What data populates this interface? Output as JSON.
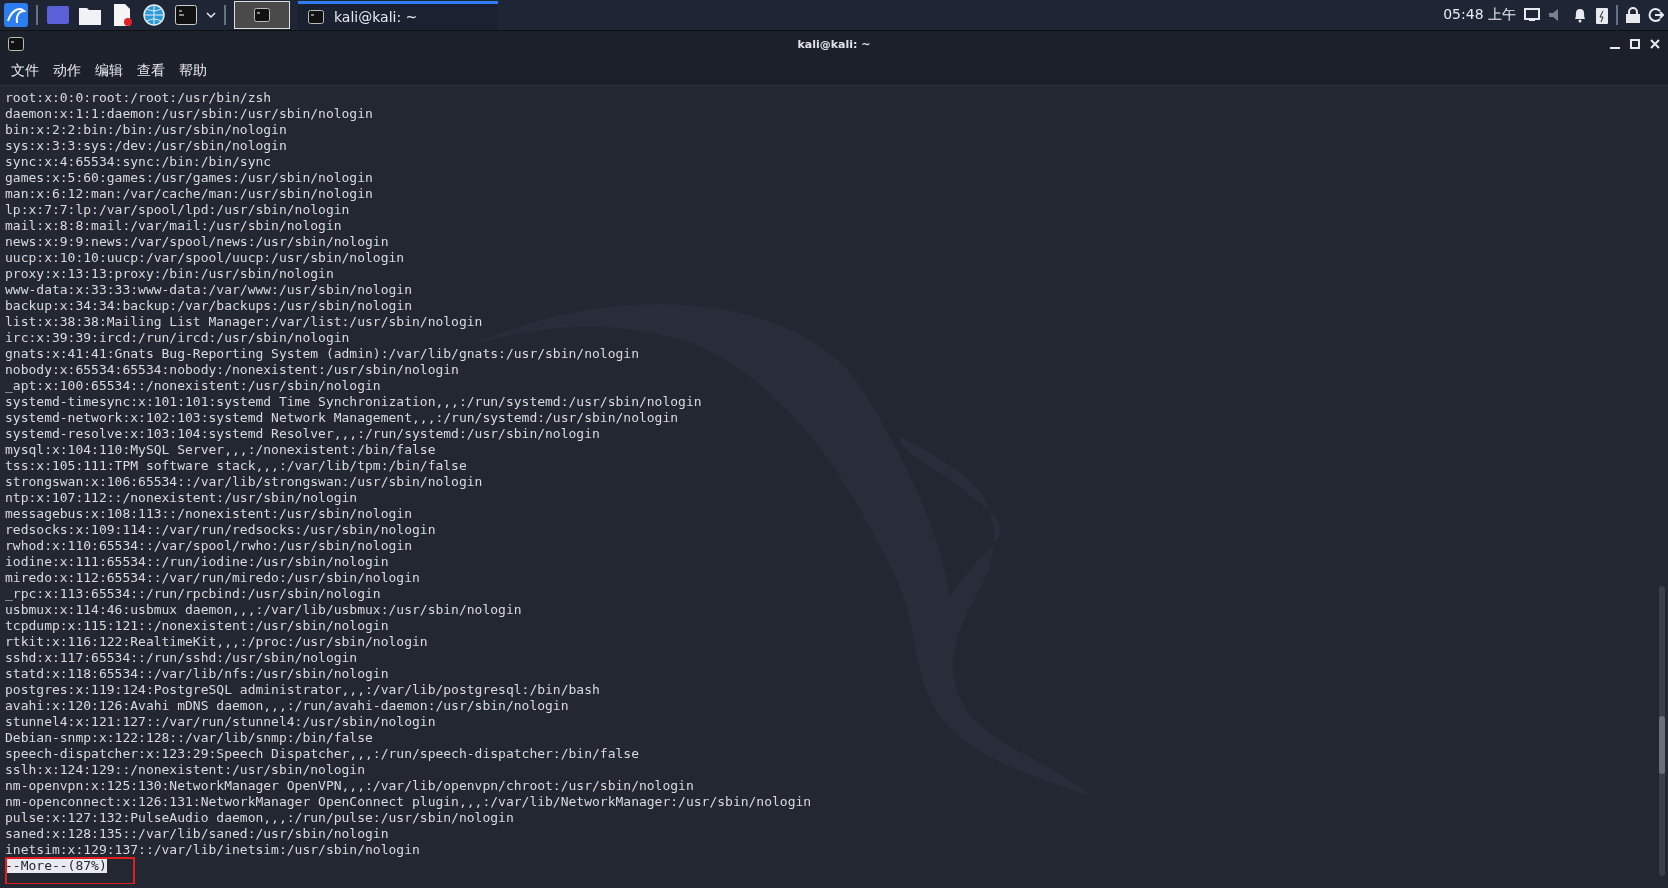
{
  "taskbar": {
    "launchers": [
      {
        "kind": "menu"
      },
      {
        "kind": "desktop"
      },
      {
        "kind": "files"
      },
      {
        "kind": "editor"
      },
      {
        "kind": "browser"
      },
      {
        "kind": "terminal"
      }
    ],
    "tasks": [
      {
        "selected": true
      },
      {
        "title": "kali@kali: ~",
        "selected": false
      }
    ],
    "clock": "05:48 上午"
  },
  "window": {
    "title": "kali@kali: ~"
  },
  "menu": [
    "文件",
    "动作",
    "编辑",
    "查看",
    "帮助"
  ],
  "terminal": {
    "lines": [
      "root:x:0:0:root:/root:/usr/bin/zsh",
      "daemon:x:1:1:daemon:/usr/sbin:/usr/sbin/nologin",
      "bin:x:2:2:bin:/bin:/usr/sbin/nologin",
      "sys:x:3:3:sys:/dev:/usr/sbin/nologin",
      "sync:x:4:65534:sync:/bin:/bin/sync",
      "games:x:5:60:games:/usr/games:/usr/sbin/nologin",
      "man:x:6:12:man:/var/cache/man:/usr/sbin/nologin",
      "lp:x:7:7:lp:/var/spool/lpd:/usr/sbin/nologin",
      "mail:x:8:8:mail:/var/mail:/usr/sbin/nologin",
      "news:x:9:9:news:/var/spool/news:/usr/sbin/nologin",
      "uucp:x:10:10:uucp:/var/spool/uucp:/usr/sbin/nologin",
      "proxy:x:13:13:proxy:/bin:/usr/sbin/nologin",
      "www-data:x:33:33:www-data:/var/www:/usr/sbin/nologin",
      "backup:x:34:34:backup:/var/backups:/usr/sbin/nologin",
      "list:x:38:38:Mailing List Manager:/var/list:/usr/sbin/nologin",
      "irc:x:39:39:ircd:/run/ircd:/usr/sbin/nologin",
      "gnats:x:41:41:Gnats Bug-Reporting System (admin):/var/lib/gnats:/usr/sbin/nologin",
      "nobody:x:65534:65534:nobody:/nonexistent:/usr/sbin/nologin",
      "_apt:x:100:65534::/nonexistent:/usr/sbin/nologin",
      "systemd-timesync:x:101:101:systemd Time Synchronization,,,:/run/systemd:/usr/sbin/nologin",
      "systemd-network:x:102:103:systemd Network Management,,,:/run/systemd:/usr/sbin/nologin",
      "systemd-resolve:x:103:104:systemd Resolver,,,:/run/systemd:/usr/sbin/nologin",
      "mysql:x:104:110:MySQL Server,,,:/nonexistent:/bin/false",
      "tss:x:105:111:TPM software stack,,,:/var/lib/tpm:/bin/false",
      "strongswan:x:106:65534::/var/lib/strongswan:/usr/sbin/nologin",
      "ntp:x:107:112::/nonexistent:/usr/sbin/nologin",
      "messagebus:x:108:113::/nonexistent:/usr/sbin/nologin",
      "redsocks:x:109:114::/var/run/redsocks:/usr/sbin/nologin",
      "rwhod:x:110:65534::/var/spool/rwho:/usr/sbin/nologin",
      "iodine:x:111:65534::/run/iodine:/usr/sbin/nologin",
      "miredo:x:112:65534::/var/run/miredo:/usr/sbin/nologin",
      "_rpc:x:113:65534::/run/rpcbind:/usr/sbin/nologin",
      "usbmux:x:114:46:usbmux daemon,,,:/var/lib/usbmux:/usr/sbin/nologin",
      "tcpdump:x:115:121::/nonexistent:/usr/sbin/nologin",
      "rtkit:x:116:122:RealtimeKit,,,:/proc:/usr/sbin/nologin",
      "sshd:x:117:65534::/run/sshd:/usr/sbin/nologin",
      "statd:x:118:65534::/var/lib/nfs:/usr/sbin/nologin",
      "postgres:x:119:124:PostgreSQL administrator,,,:/var/lib/postgresql:/bin/bash",
      "avahi:x:120:126:Avahi mDNS daemon,,,:/run/avahi-daemon:/usr/sbin/nologin",
      "stunnel4:x:121:127::/var/run/stunnel4:/usr/sbin/nologin",
      "Debian-snmp:x:122:128::/var/lib/snmp:/bin/false",
      "speech-dispatcher:x:123:29:Speech Dispatcher,,,:/run/speech-dispatcher:/bin/false",
      "sslh:x:124:129::/nonexistent:/usr/sbin/nologin",
      "nm-openvpn:x:125:130:NetworkManager OpenVPN,,,:/var/lib/openvpn/chroot:/usr/sbin/nologin",
      "nm-openconnect:x:126:131:NetworkManager OpenConnect plugin,,,:/var/lib/NetworkManager:/usr/sbin/nologin",
      "pulse:x:127:132:PulseAudio daemon,,,:/run/pulse:/usr/sbin/nologin",
      "saned:x:128:135::/var/lib/saned:/usr/sbin/nologin",
      "inetsim:x:129:137::/var/lib/inetsim:/usr/sbin/nologin"
    ],
    "prompt": "--More--(87%)",
    "prompt_highlighted": true
  }
}
